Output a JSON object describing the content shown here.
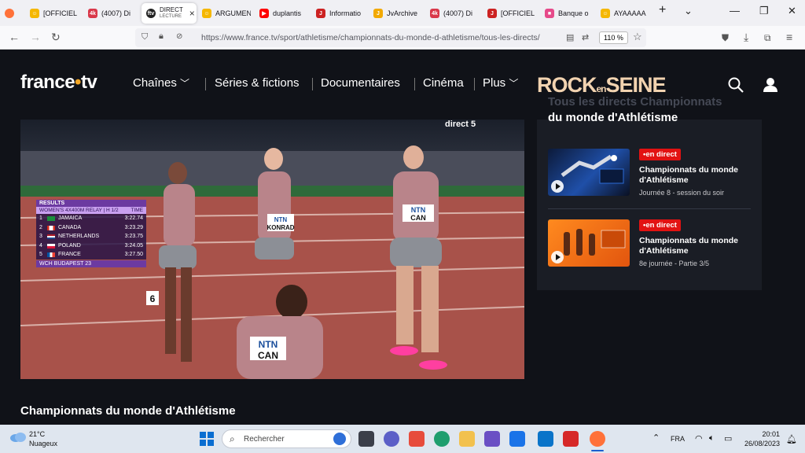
{
  "browser": {
    "tabs": [
      {
        "label": "[OFFICIEL",
        "icon": "smiley-icon",
        "color": "#f5b700"
      },
      {
        "label": "(4007) Di",
        "icon": "forum-icon",
        "color": "#d9384a"
      },
      {
        "label_line1": "DIRECT",
        "label_line2": "LECTURE",
        "icon": "france-tv-icon",
        "color": "#222"
      },
      {
        "label": "ARGUMEN",
        "icon": "smiley-icon",
        "color": "#f5b700"
      },
      {
        "label": "duplantis",
        "icon": "youtube-icon",
        "color": "#ff0000"
      },
      {
        "label": "Informatio",
        "icon": "jv-icon",
        "color": "#cc2222"
      },
      {
        "label": "JvArchive",
        "icon": "jvarchive-icon",
        "color": "#f2a900"
      },
      {
        "label": "(4007) Di",
        "icon": "forum-icon",
        "color": "#d9384a"
      },
      {
        "label": "[OFFICIEL",
        "icon": "jv-icon",
        "color": "#cc2222"
      },
      {
        "label": "Banque o",
        "icon": "bank-icon",
        "color": "#e64a8a"
      },
      {
        "label": "AYAAAAA",
        "icon": "smiley-icon",
        "color": "#f5b700"
      }
    ],
    "url": "https://www.france.tv/sport/athletisme/championnats-du-monde-d-athletisme/tous-les-directs/",
    "zoom": "110 %"
  },
  "site": {
    "logo_main": "france",
    "logo_dot": "•",
    "logo_tv": "tv",
    "menu": [
      "Chaînes",
      "Séries & fictions",
      "Documentaires",
      "Cinéma",
      "Plus"
    ],
    "promo_left": "ROCK",
    "promo_mid": "en",
    "promo_right": "SEINE",
    "panel_title_faded": "Tous les directs Championnats",
    "panel_title": "du monde d'Athlétisme",
    "cards": [
      {
        "badge": "•en direct",
        "title": "Championnats du monde d'Athlétisme",
        "subtitle": "Journée 8 - session du soir"
      },
      {
        "badge": "•en direct",
        "title": "Championnats du monde d'Athlétisme",
        "subtitle": "8e journée - Partie 3/5"
      }
    ],
    "bottom_title": "Championnats du monde d'Athlétisme"
  },
  "video": {
    "channel_badge": "direct 5",
    "results": {
      "header": "RESULTS",
      "event": "WOMEN'S 4X400M RELAY | H 1/2",
      "time_label": "TIME",
      "rows": [
        {
          "pos": "1",
          "country": "JAMAICA",
          "time": "3:22.74",
          "flag": "#1a8f3c"
        },
        {
          "pos": "2",
          "country": "CANADA",
          "time": "3:23.29",
          "flag": "#d52b1e"
        },
        {
          "pos": "3",
          "country": "NETHERLANDS",
          "time": "3:23.75",
          "flag": "#21468b"
        },
        {
          "pos": "4",
          "country": "POLAND",
          "time": "3:24.05",
          "flag": "#dc143c"
        },
        {
          "pos": "5",
          "country": "FRANCE",
          "time": "3:27.50",
          "flag": "#0055a4"
        }
      ],
      "footer": "WCH BUDAPEST 23"
    },
    "bibs": [
      "NTN",
      "CAN",
      "NTN",
      "KONRAD",
      "NTN",
      "CAN",
      "6"
    ]
  },
  "taskbar": {
    "temp": "21°C",
    "condition": "Nuageux",
    "search_placeholder": "Rechercher",
    "lang": "FRA",
    "time": "20:01",
    "date": "26/08/2023"
  }
}
